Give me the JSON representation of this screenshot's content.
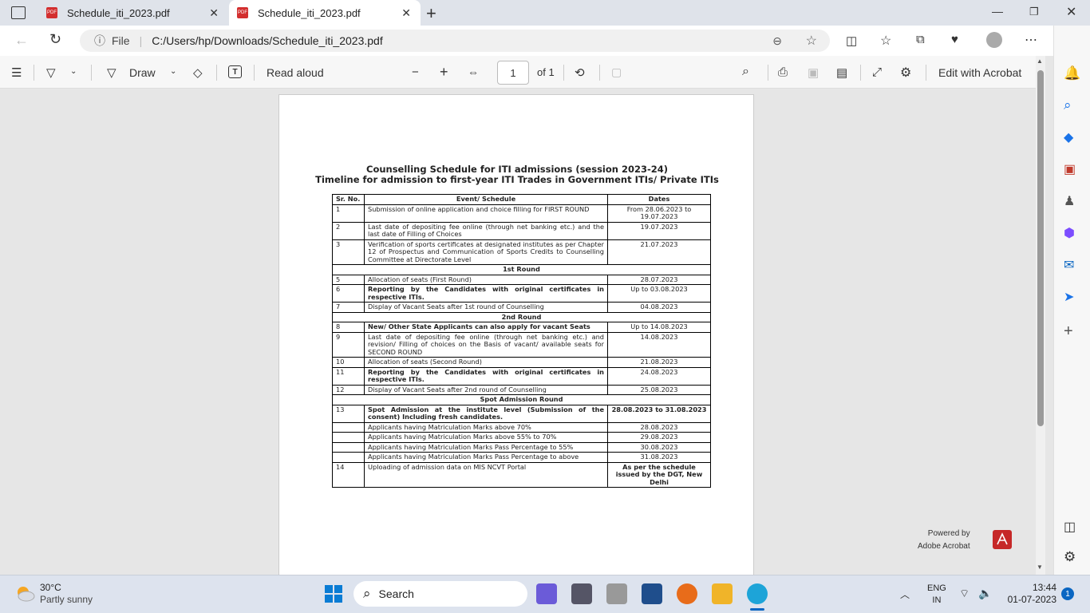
{
  "browser": {
    "tabs": [
      {
        "title": "Schedule_iti_2023.pdf"
      },
      {
        "title": "Schedule_iti_2023.pdf"
      }
    ],
    "url_prefix": "File",
    "url": "C:/Users/hp/Downloads/Schedule_iti_2023.pdf"
  },
  "pdf_toolbar": {
    "draw": "Draw",
    "read_aloud": "Read aloud",
    "page_number": "1",
    "page_total": "of 1",
    "edit_acrobat": "Edit with Acrobat"
  },
  "document": {
    "title_line1": "Counselling Schedule for ITI admissions (session 2023-24)",
    "title_line2": "Timeline for admission to first-year ITI Trades in Government ITIs/ Private ITIs",
    "headers": {
      "sr": "Sr. No.",
      "event": "Event/ Schedule",
      "dates": "Dates"
    },
    "rows": [
      {
        "sr": "1",
        "event": "Submission of online application and choice filling for FIRST ROUND",
        "dates": "From 28.06.2023 to 19.07.2023"
      },
      {
        "sr": "2",
        "event": "Last date of depositing fee online (through net banking etc.) and the last date of Filling of Choices",
        "dates": "19.07.2023"
      },
      {
        "sr": "3",
        "event": "Verification of sports certificates at designated institutes as per Chapter 12 of Prospectus and Communication of Sports Credits to Counselling Committee at Directorate Level",
        "dates": "21.07.2023"
      },
      {
        "round": "1st Round"
      },
      {
        "sr": "5",
        "event": "Allocation of seats (First Round)",
        "dates": "28.07.2023"
      },
      {
        "sr": "6",
        "event": "Reporting by the Candidates with original certificates in respective ITIs.",
        "dates": "Up to 03.08.2023"
      },
      {
        "sr": "7",
        "event": "Display of Vacant  Seats after  1st round of Counselling",
        "dates": "04.08.2023"
      },
      {
        "round": "2nd Round"
      },
      {
        "sr": "8",
        "event": "New/ Other State Applicants can also apply for vacant Seats",
        "dates": "Up to 14.08.2023"
      },
      {
        "sr": "9",
        "event": "Last date of depositing fee online (through net banking etc.) and revision/ Filling of  choices on the Basis of vacant/ available seats for SECOND ROUND",
        "dates": "14.08.2023"
      },
      {
        "sr": "10",
        "event": "Allocation of seats (Second Round)",
        "dates": "21.08.2023"
      },
      {
        "sr": "11",
        "event": "Reporting by the Candidates with original certificates in respective ITIs.",
        "dates": "24.08.2023"
      },
      {
        "sr": "12",
        "event": "Display of Vacant  Seats after 2nd round of Counselling",
        "dates": "25.08.2023"
      },
      {
        "round": "Spot Admission Round"
      },
      {
        "sr": "13",
        "event": "Spot Admission at the institute level (Submission of the consent) Including fresh candidates.",
        "dates": "28.08.2023 to 31.08.2023"
      },
      {
        "sr": "",
        "event": "Applicants having Matriculation Marks above 70%",
        "dates": "28.08.2023"
      },
      {
        "sr": "",
        "event": "Applicants having Matriculation Marks above 55% to 70%",
        "dates": "29.08.2023"
      },
      {
        "sr": "",
        "event": "Applicants having Matriculation Marks Pass Percentage to 55%",
        "dates": "30.08.2023"
      },
      {
        "sr": "",
        "event": "Applicants having Matriculation Marks Pass Percentage to above",
        "dates": "31.08.2023"
      },
      {
        "sr": "14",
        "event": "Uploading of admission data on MIS NCVT Portal",
        "dates": "As per the schedule issued by the DGT, New Delhi"
      }
    ]
  },
  "powered": {
    "line1": "Powered by",
    "line2": "Adobe Acrobat"
  },
  "taskbar": {
    "weather_temp": "30°C",
    "weather_desc": "Partly sunny",
    "search": "Search",
    "lang1": "ENG",
    "lang2": "IN",
    "time": "13:44",
    "date": "01-07-2023",
    "notif": "1"
  }
}
